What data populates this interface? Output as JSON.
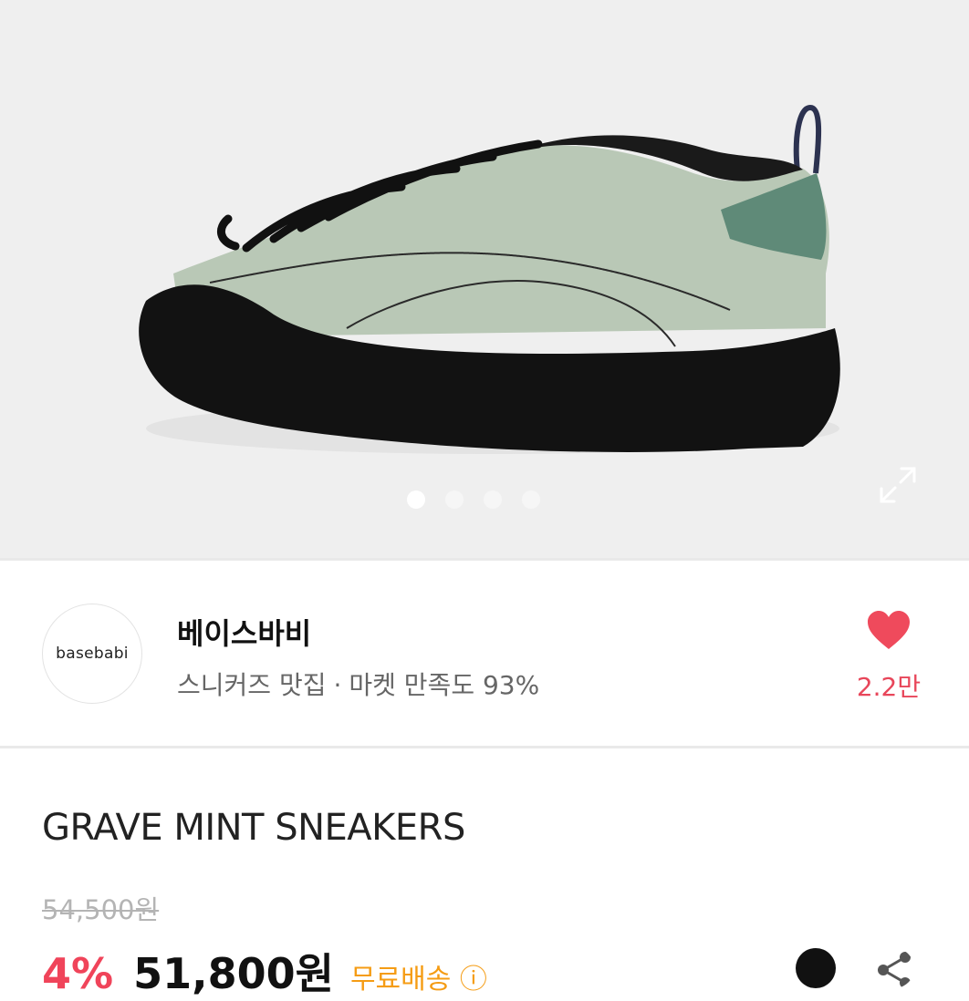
{
  "gallery": {
    "image_alt": "Grave mint sneaker side view",
    "slides": [
      "slide-1",
      "slide-2",
      "slide-3",
      "slide-4"
    ],
    "active_slide": 0,
    "expand_icon": "expand-icon"
  },
  "shop": {
    "logo_text": "basebabi",
    "name": "베이스바비",
    "tagline": "스니커즈 맛집",
    "separator": "·",
    "satisfaction": "마켓 만족도 93%",
    "like_icon": "heart-icon",
    "like_count": "2.2만",
    "accent": "#e8465a"
  },
  "product": {
    "name": "GRAVE MINT SNEAKERS",
    "original_price": "54,500원",
    "discount": "4%",
    "sale_price": "51,800원",
    "shipping_badge": "무료배송 ⓘ",
    "discount_color": "#f0445a",
    "badge_color": "#f59c14"
  }
}
